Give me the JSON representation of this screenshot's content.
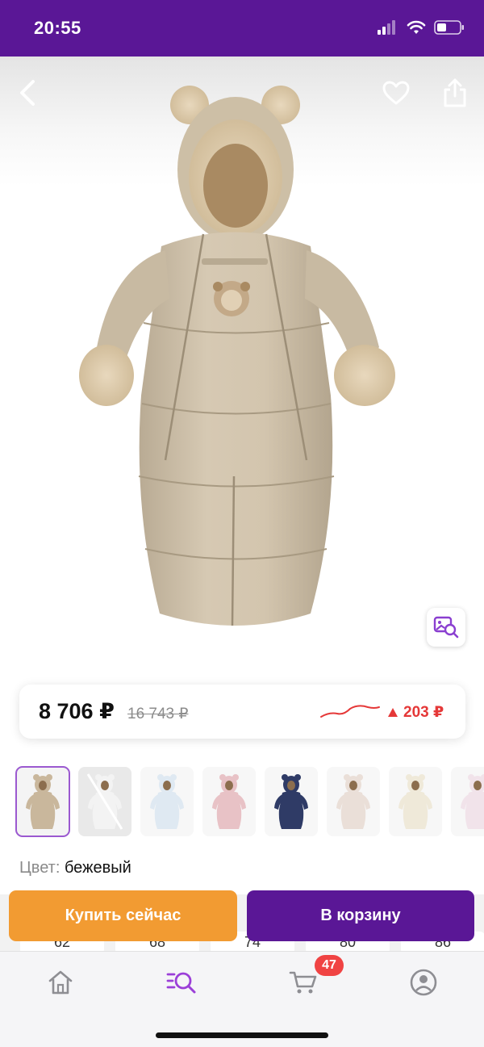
{
  "status_bar": {
    "time": "20:55"
  },
  "product": {
    "price_current": "8 706 ₽",
    "price_old": "16 743 ₽",
    "price_change": "203 ₽",
    "price_change_direction": "up",
    "price_change_color": "#e53838",
    "color_label": "Цвет:",
    "color_value": "бежевый"
  },
  "variants": [
    {
      "tone": "#c9b79c",
      "selected": true,
      "available": true
    },
    {
      "tone": "#f3f3f3",
      "selected": false,
      "available": false
    },
    {
      "tone": "#dfe9f2",
      "selected": false,
      "available": true
    },
    {
      "tone": "#e8c2c6",
      "selected": false,
      "available": true
    },
    {
      "tone": "#2f3b66",
      "selected": false,
      "available": true
    },
    {
      "tone": "#eadfd8",
      "selected": false,
      "available": true
    },
    {
      "tone": "#efe9d9",
      "selected": false,
      "available": true
    },
    {
      "tone": "#f1e3ea",
      "selected": false,
      "available": true
    }
  ],
  "sizes": [
    "62",
    "68",
    "74",
    "80",
    "86"
  ],
  "actions": {
    "buy_now_label": "Купить сейчас",
    "add_to_cart_label": "В корзину"
  },
  "tabbar": {
    "cart_badge": "47",
    "items": [
      "home-icon",
      "catalog-search-icon",
      "cart-icon",
      "profile-icon"
    ],
    "active": "catalog-search-icon"
  },
  "colors": {
    "brand": "#5a1796",
    "buy_now": "#f29b32",
    "accent_active_tab": "#9b3fd8",
    "badge": "#f04343"
  }
}
